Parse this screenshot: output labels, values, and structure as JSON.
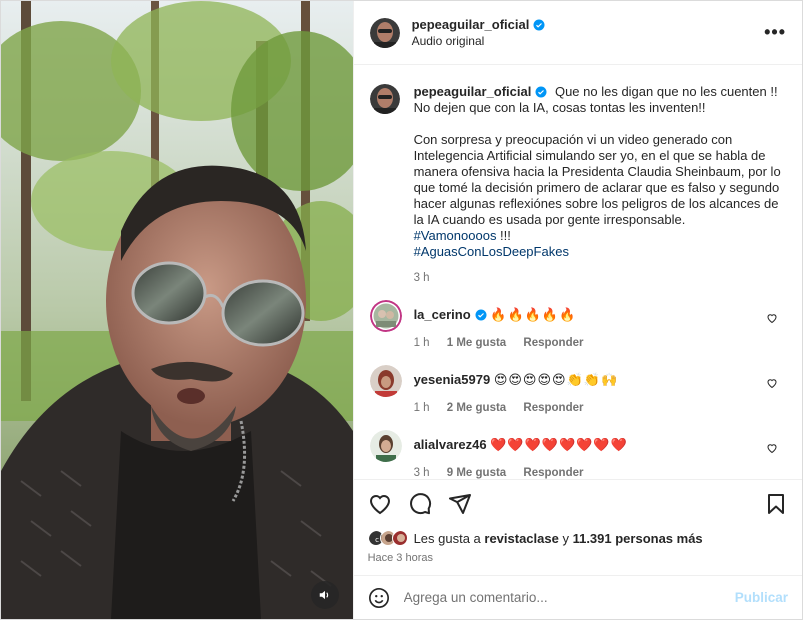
{
  "post": {
    "username": "pepeaguilar_oficial",
    "audio": "Audio original",
    "more": "•••"
  },
  "caption": {
    "username": "pepeaguilar_oficial",
    "line1": "Que no les digan que no les cuenten !!",
    "line2": "No dejen que con la IA, cosas tontas les inventen!!",
    "paragraph": "Con sorpresa y preocupación vi un video generado con Intelegencia Artificial simulando ser yo, en el que se habla de manera ofensiva hacia la Presidenta Claudia Sheinbaum, por lo que tomé la decisión primero de aclarar que es falso y segundo hacer algunas reflexiónes sobre los peligros de los alcances de la IA cuando es usada por gente irresponsable.",
    "hashtag1": "#Vamonoooos",
    "hashtag1_suffix": " !!!",
    "hashtag2": "#AguasConLosDeepFakes",
    "time": "3 h"
  },
  "comments": [
    {
      "username": "la_cerino",
      "verified": true,
      "text": "🔥🔥🔥🔥🔥",
      "time": "1 h",
      "likes": "1 Me gusta",
      "reply": "Responder"
    },
    {
      "username": "yesenia5979",
      "verified": false,
      "text": "😍😍😍😍😍👏👏🙌",
      "time": "1 h",
      "likes": "2 Me gusta",
      "reply": "Responder"
    },
    {
      "username": "alialvarez46",
      "verified": false,
      "text": "❤️❤️❤️❤️❤️❤️❤️❤️",
      "time": "3 h",
      "likes": "9 Me gusta",
      "reply": "Responder"
    }
  ],
  "likes": {
    "prefix": "Les gusta a ",
    "user": "revistaclase",
    "middle": " y ",
    "count": "11.391 personas más"
  },
  "posted": "Hace 3 horas",
  "comment_input": {
    "placeholder": "Agrega un comentario...",
    "publish": "Publicar"
  },
  "colors": {
    "verified": "#0095f6",
    "hashtag": "#00376b",
    "muted": "#737373",
    "publish": "#b2dffc"
  }
}
